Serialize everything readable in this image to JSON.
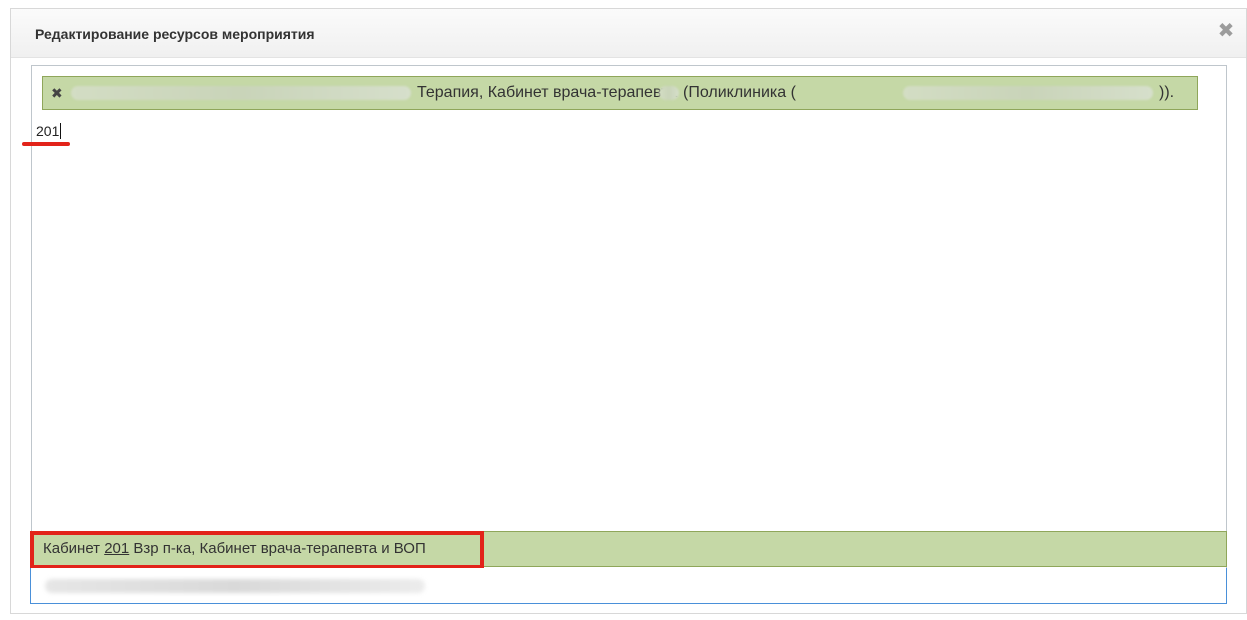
{
  "dialog": {
    "title": "Редактирование ресурсов мероприятия",
    "close_icon": "close-icon"
  },
  "editor": {
    "selected_tag": {
      "remove_icon": "remove-tag-icon",
      "remove_glyph": "✖",
      "text_part1": "Терапия, Кабинет врача-терапевта",
      "text_part2": "(Поликлиника (",
      "text_part3": "))."
    },
    "search_value": "201"
  },
  "dropdown": {
    "highlighted_prefix": "Кабинет ",
    "highlighted_match": "201",
    "highlighted_suffix": " Взр п-ка, Кабинет врача-терапевта и ВОП"
  },
  "colors": {
    "tag_bg": "#c5d8a6",
    "tag_border": "#8fa65a",
    "highlight": "#e2231a",
    "focus_border": "#4a90d9"
  }
}
